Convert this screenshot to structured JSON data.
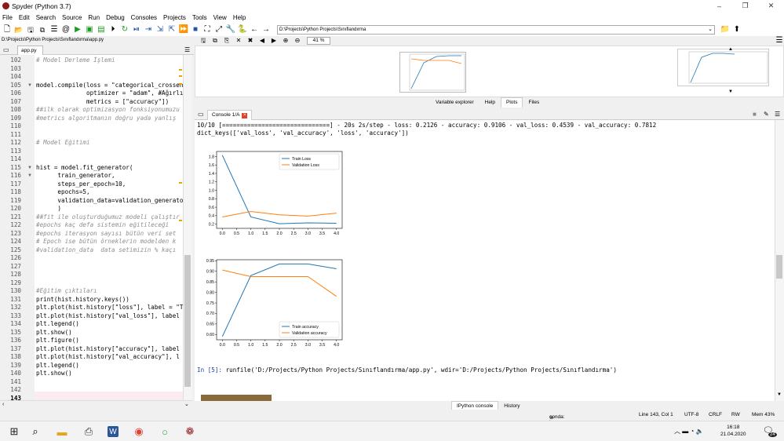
{
  "window": {
    "title": "Spyder (Python 3.7)",
    "minimize": "–",
    "maximize": "❐",
    "close": "✕"
  },
  "menu": [
    "File",
    "Edit",
    "Search",
    "Source",
    "Run",
    "Debug",
    "Consoles",
    "Projects",
    "Tools",
    "View",
    "Help"
  ],
  "toolbar": {
    "working_dir": "D:\\Projects\\Python Projects\\Sınıflandırma"
  },
  "editor": {
    "path": "D:\\Projects\\Python Projects\\Sınıflandırma\\app.py",
    "tab": "app.py",
    "lines": [
      {
        "n": "102",
        "t": "# Model Derleme İşlemi",
        "c": "cm"
      },
      {
        "n": "103",
        "t": ""
      },
      {
        "n": "104",
        "t": ""
      },
      {
        "n": "105",
        "t": "model.compile(loss = \"categorical_crossentropy\",",
        "fold": true
      },
      {
        "n": "106",
        "t": "              optimizer = \"adam\", #Ağırlık"
      },
      {
        "n": "107",
        "t": "              metrics = [\"accuracy\"])"
      },
      {
        "n": "108",
        "t": "##ilk olarak optimizasyon fonksiyonumuzu",
        "c": "cm"
      },
      {
        "n": "109",
        "t": "#metrics algoritmanın doğru yada yanlış",
        "c": "cm"
      },
      {
        "n": "110",
        "t": ""
      },
      {
        "n": "111",
        "t": ""
      },
      {
        "n": "112",
        "t": "# Model Eğitimi",
        "c": "cm"
      },
      {
        "n": "113",
        "t": ""
      },
      {
        "n": "114",
        "t": ""
      },
      {
        "n": "115",
        "t": "hist = model.fit_generator(",
        "fold": true
      },
      {
        "n": "116",
        "t": "      train_generator,",
        "fold": true
      },
      {
        "n": "117",
        "t": "      steps_per_epoch=10,"
      },
      {
        "n": "118",
        "t": "      epochs=5,"
      },
      {
        "n": "119",
        "t": "      validation_data=validation_generator"
      },
      {
        "n": "120",
        "t": "      )"
      },
      {
        "n": "121",
        "t": "##fit ile oluşturduğumuz modeli çalıştır",
        "c": "cm"
      },
      {
        "n": "122",
        "t": "#epochs kaç defa sistemin eğitileceği",
        "c": "cm"
      },
      {
        "n": "123",
        "t": "#epochs iterasyon sayısı bütün veri set",
        "c": "cm"
      },
      {
        "n": "124",
        "t": "# Epoch ise bütün örneklerin modelden k",
        "c": "cm"
      },
      {
        "n": "125",
        "t": "#validation_data  data setimizin % kaçı",
        "c": "cm"
      },
      {
        "n": "126",
        "t": ""
      },
      {
        "n": "127",
        "t": ""
      },
      {
        "n": "128",
        "t": ""
      },
      {
        "n": "129",
        "t": ""
      },
      {
        "n": "130",
        "t": "#Eğitim çıktıları",
        "c": "cm"
      },
      {
        "n": "131",
        "t": "print(hist.history.keys())"
      },
      {
        "n": "132",
        "t": "plt.plot(hist.history[\"loss\"], label = \"Tr"
      },
      {
        "n": "133",
        "t": "plt.plot(hist.history[\"val_loss\"], label"
      },
      {
        "n": "134",
        "t": "plt.legend()"
      },
      {
        "n": "135",
        "t": "plt.show()"
      },
      {
        "n": "136",
        "t": "plt.figure()"
      },
      {
        "n": "137",
        "t": "plt.plot(hist.history[\"accuracy\"], label"
      },
      {
        "n": "138",
        "t": "plt.plot(hist.history[\"val_accuracy\"], l"
      },
      {
        "n": "139",
        "t": "plt.legend()"
      },
      {
        "n": "140",
        "t": "plt.show()"
      },
      {
        "n": "141",
        "t": ""
      },
      {
        "n": "142",
        "t": ""
      },
      {
        "n": "143",
        "t": "",
        "current": true
      }
    ]
  },
  "plots": {
    "zoom": "41 %",
    "tabs": [
      "Variable explorer",
      "Help",
      "Plots",
      "Files"
    ],
    "active_tab": "Plots"
  },
  "console": {
    "tab": "Console 1/A",
    "progress_line": "10/10 [==============================] - 20s 2s/step - loss: 0.2126 - accuracy: 0.9106 - val_loss: 0.4539 - val_accuracy: 0.7812",
    "keys_line": "dict_keys(['val_loss', 'val_accuracy', 'loss', 'accuracy'])",
    "prompt": "In [5]:",
    "command": " runfile('D:/Projects/Python Projects/Sınıflandırma/app.py', wdir='D:/Projects/Python Projects/Sınıflandırma')",
    "bottom_tabs": [
      "IPython console",
      "History"
    ]
  },
  "chart_data": [
    {
      "type": "line",
      "x": [
        0,
        1,
        2,
        3,
        4
      ],
      "series": [
        {
          "name": "Train Loss",
          "color": "#1f77b4",
          "values": [
            1.83,
            0.37,
            0.21,
            0.23,
            0.22
          ]
        },
        {
          "name": "Validation Loss",
          "color": "#ff7f0e",
          "values": [
            0.37,
            0.5,
            0.42,
            0.39,
            0.46
          ]
        }
      ],
      "xticks": [
        "0.0",
        "0.5",
        "1.0",
        "1.5",
        "2.0",
        "2.5",
        "3.0",
        "3.5",
        "4.0"
      ],
      "yticks": [
        "0.2",
        "0.4",
        "0.6",
        "0.8",
        "1.0",
        "1.2",
        "1.4",
        "1.6",
        "1.8"
      ],
      "xlim": [
        -0.2,
        4.2
      ],
      "ylim": [
        0.1,
        1.92
      ],
      "legend": "top-right"
    },
    {
      "type": "line",
      "x": [
        0,
        1,
        2,
        3,
        4
      ],
      "series": [
        {
          "name": "Train accuracy",
          "color": "#1f77b4",
          "values": [
            0.59,
            0.88,
            0.935,
            0.935,
            0.912
          ]
        },
        {
          "name": "Validation accuracy",
          "color": "#ff7f0e",
          "values": [
            0.906,
            0.875,
            0.875,
            0.875,
            0.781
          ]
        }
      ],
      "xticks": [
        "0.0",
        "0.5",
        "1.0",
        "1.5",
        "2.0",
        "2.5",
        "3.0",
        "3.5",
        "4.0"
      ],
      "yticks": [
        "0.60",
        "0.65",
        "0.70",
        "0.75",
        "0.80",
        "0.85",
        "0.90",
        "0.95"
      ],
      "xlim": [
        -0.2,
        4.2
      ],
      "ylim": [
        0.575,
        0.955
      ],
      "legend": "bottom-right"
    }
  ],
  "status": {
    "env": "conda: base (Python 3.7.6)",
    "position": "Line 143, Col 1",
    "encoding": "UTF-8",
    "eol": "CRLF",
    "perm": "RW",
    "mem": "Mem 43%"
  },
  "taskbar": {
    "time": "16:18",
    "date": "21.04.2020",
    "notifications": "24"
  }
}
